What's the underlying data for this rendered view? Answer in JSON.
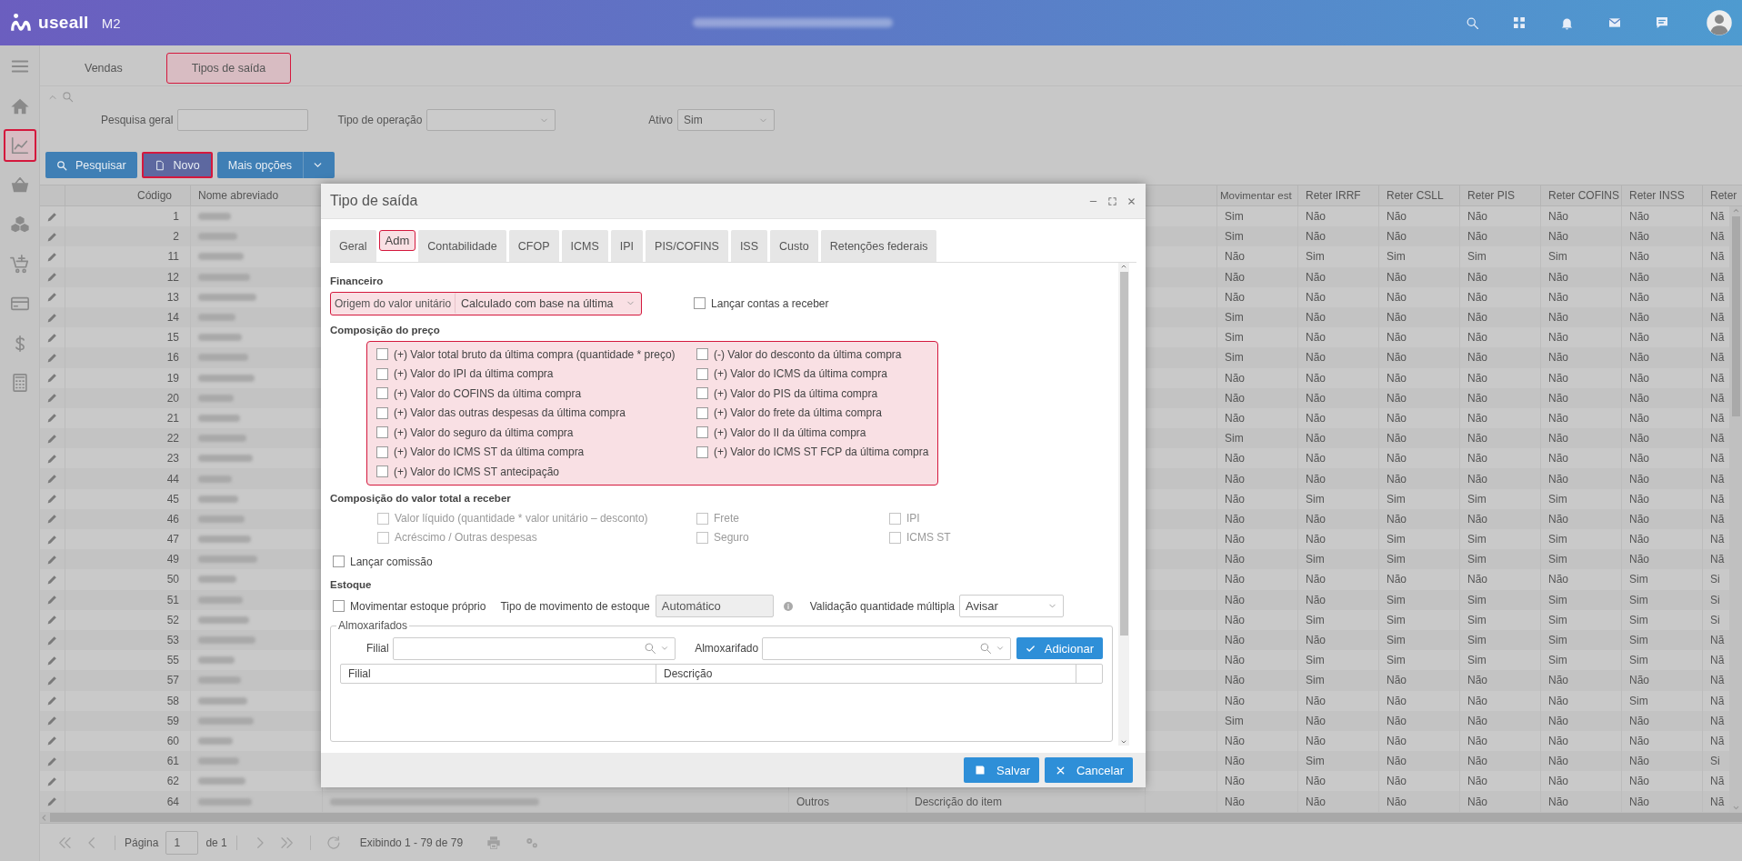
{
  "header": {
    "logo": "useall",
    "product": "M2"
  },
  "sidebar": {
    "items": [
      {
        "kind": "menu",
        "highlighted": false
      },
      {
        "kind": "home",
        "highlighted": false
      },
      {
        "kind": "chart",
        "highlighted": true
      },
      {
        "kind": "basket",
        "highlighted": false
      },
      {
        "kind": "cubes",
        "highlighted": false
      },
      {
        "kind": "cart",
        "highlighted": false
      },
      {
        "kind": "card",
        "highlighted": false
      },
      {
        "kind": "dollar",
        "highlighted": false
      },
      {
        "kind": "calculator",
        "highlighted": false
      }
    ]
  },
  "tabs": [
    {
      "label": "Vendas",
      "selected": false
    },
    {
      "label": "Tipos de saída",
      "selected": true
    }
  ],
  "filters": {
    "search_label": "Pesquisa geral",
    "operation_label": "Tipo de operação",
    "active_label": "Ativo",
    "active_value": "Sim"
  },
  "toolbar": [
    {
      "label": "Pesquisar",
      "kind": "search",
      "highlighted": false
    },
    {
      "label": "Novo",
      "kind": "file",
      "highlighted": true
    },
    {
      "label": "Mais opções",
      "kind": "caret",
      "highlighted": false
    }
  ],
  "table": {
    "columns": [
      "Código",
      "Nome abreviado",
      "",
      "",
      "",
      "",
      "Movimentar est",
      "Reter IRRF",
      "Reter CSLL",
      "Reter PIS",
      "Reter COFINS",
      "Reter INSS",
      "Reter"
    ],
    "rows": [
      {
        "cells": [
          "1",
          "",
          "",
          "",
          "",
          "",
          "Sim",
          "Não",
          "Não",
          "Não",
          "Não",
          "Não",
          "Nã"
        ]
      },
      {
        "cells": [
          "2",
          "",
          "",
          "",
          "",
          "",
          "Sim",
          "Não",
          "Não",
          "Não",
          "Não",
          "Não",
          "Nã"
        ]
      },
      {
        "cells": [
          "11",
          "",
          "",
          "",
          "",
          "",
          "Não",
          "Sim",
          "Sim",
          "Sim",
          "Sim",
          "Não",
          "Nã"
        ]
      },
      {
        "cells": [
          "12",
          "",
          "",
          "",
          "",
          "",
          "Não",
          "Não",
          "Não",
          "Não",
          "Não",
          "Não",
          "Nã"
        ]
      },
      {
        "cells": [
          "13",
          "",
          "",
          "",
          "",
          "",
          "Não",
          "Não",
          "Não",
          "Não",
          "Não",
          "Não",
          "Nã"
        ]
      },
      {
        "cells": [
          "14",
          "",
          "",
          "",
          "",
          "",
          "Sim",
          "Não",
          "Não",
          "Não",
          "Não",
          "Não",
          "Nã"
        ]
      },
      {
        "cells": [
          "15",
          "",
          "",
          "",
          "",
          "",
          "Sim",
          "Não",
          "Não",
          "Não",
          "Não",
          "Não",
          "Nã"
        ]
      },
      {
        "cells": [
          "16",
          "",
          "",
          "",
          "",
          "",
          "Sim",
          "Não",
          "Não",
          "Não",
          "Não",
          "Não",
          "Nã"
        ]
      },
      {
        "cells": [
          "19",
          "",
          "",
          "",
          "",
          "",
          "Não",
          "Não",
          "Não",
          "Não",
          "Não",
          "Não",
          "Nã"
        ]
      },
      {
        "cells": [
          "20",
          "",
          "",
          "",
          "",
          "",
          "Não",
          "Não",
          "Não",
          "Não",
          "Não",
          "Não",
          "Nã"
        ]
      },
      {
        "cells": [
          "21",
          "",
          "",
          "",
          "",
          "",
          "Não",
          "Não",
          "Não",
          "Não",
          "Não",
          "Não",
          "Nã"
        ]
      },
      {
        "cells": [
          "22",
          "",
          "",
          "",
          "",
          "",
          "Sim",
          "Não",
          "Não",
          "Não",
          "Não",
          "Não",
          "Nã"
        ]
      },
      {
        "cells": [
          "23",
          "",
          "",
          "",
          "",
          "",
          "Não",
          "Não",
          "Não",
          "Não",
          "Não",
          "Não",
          "Nã"
        ]
      },
      {
        "cells": [
          "44",
          "",
          "",
          "",
          "",
          "",
          "Não",
          "Não",
          "Não",
          "Não",
          "Não",
          "Não",
          "Nã"
        ]
      },
      {
        "cells": [
          "45",
          "",
          "",
          "",
          "",
          "",
          "Não",
          "Sim",
          "Sim",
          "Sim",
          "Sim",
          "Não",
          "Nã"
        ]
      },
      {
        "cells": [
          "46",
          "",
          "",
          "",
          "",
          "",
          "Não",
          "Não",
          "Não",
          "Não",
          "Não",
          "Não",
          "Nã"
        ]
      },
      {
        "cells": [
          "47",
          "",
          "",
          "",
          "",
          "",
          "Não",
          "Não",
          "Sim",
          "Sim",
          "Sim",
          "Não",
          "Nã"
        ]
      },
      {
        "cells": [
          "49",
          "",
          "",
          "",
          "",
          "",
          "Não",
          "Sim",
          "Sim",
          "Sim",
          "Sim",
          "Não",
          "Nã"
        ]
      },
      {
        "cells": [
          "50",
          "",
          "",
          "",
          "",
          "",
          "Não",
          "Não",
          "Não",
          "Não",
          "Não",
          "Sim",
          "Si"
        ]
      },
      {
        "cells": [
          "51",
          "",
          "",
          "",
          "",
          "",
          "Não",
          "Não",
          "Sim",
          "Sim",
          "Sim",
          "Sim",
          "Si"
        ]
      },
      {
        "cells": [
          "52",
          "",
          "",
          "",
          "",
          "",
          "Não",
          "Sim",
          "Sim",
          "Sim",
          "Sim",
          "Sim",
          "Si"
        ]
      },
      {
        "cells": [
          "53",
          "",
          "",
          "",
          "",
          "",
          "Não",
          "Não",
          "Sim",
          "Sim",
          "Sim",
          "Sim",
          "Nã"
        ]
      },
      {
        "cells": [
          "55",
          "",
          "",
          "",
          "",
          "",
          "Não",
          "Sim",
          "Sim",
          "Sim",
          "Sim",
          "Sim",
          "Nã"
        ]
      },
      {
        "cells": [
          "57",
          "",
          "",
          "",
          "",
          "",
          "Não",
          "Sim",
          "Não",
          "Não",
          "Não",
          "Não",
          "Nã"
        ]
      },
      {
        "cells": [
          "58",
          "",
          "",
          "",
          "",
          "",
          "Não",
          "Não",
          "Não",
          "Não",
          "Não",
          "Sim",
          "Nã"
        ]
      },
      {
        "cells": [
          "59",
          "",
          "",
          "",
          "",
          "",
          "Sim",
          "Não",
          "Não",
          "Não",
          "Não",
          "Não",
          "Nã"
        ]
      },
      {
        "cells": [
          "60",
          "",
          "",
          "",
          "",
          "",
          "Não",
          "Não",
          "Não",
          "Não",
          "Não",
          "Não",
          "Nã"
        ]
      },
      {
        "cells": [
          "61",
          "",
          "",
          "",
          "",
          "",
          "Não",
          "Sim",
          "Não",
          "Não",
          "Não",
          "Não",
          "Si"
        ]
      },
      {
        "cells": [
          "62",
          "",
          "",
          "",
          "",
          "",
          "Não",
          "Não",
          "Não",
          "Não",
          "Não",
          "Não",
          "Nã"
        ]
      },
      {
        "cells": [
          "64",
          "",
          "",
          "Outros",
          "Descrição do item",
          "",
          "Não",
          "Não",
          "Não",
          "Não",
          "Não",
          "Não",
          "Nã"
        ]
      }
    ]
  },
  "pager": {
    "page_label": "Página",
    "page": "1",
    "page_total": "de 1",
    "summary": "Exibindo 1 - 79 de 79"
  },
  "modal": {
    "title": "Tipo de saída",
    "tabs": [
      {
        "label": "Geral",
        "selected": false
      },
      {
        "label": "Adm",
        "selected": true
      },
      {
        "label": "Contabilidade",
        "selected": false
      },
      {
        "label": "CFOP",
        "selected": false
      },
      {
        "label": "ICMS",
        "selected": false
      },
      {
        "label": "IPI",
        "selected": false
      },
      {
        "label": "PIS/COFINS",
        "selected": false
      },
      {
        "label": "ISS",
        "selected": false
      },
      {
        "label": "Custo",
        "selected": false
      },
      {
        "label": "Retenções federais",
        "selected": false
      }
    ],
    "financeiro": {
      "heading": "Financeiro",
      "origin_label": "Origem do valor unitário",
      "origin_value": "Calculado com base na última",
      "highlighted": true,
      "receivable": {
        "label": "Lançar contas a receber",
        "checked": false
      }
    },
    "price": {
      "heading": "Composição do preço",
      "highlighted": true,
      "columns": [
        [
          {
            "label": "(+) Valor total bruto da última compra (quantidade * preço)",
            "checked": false
          },
          {
            "label": "(+) Valor do IPI da última compra",
            "checked": false
          },
          {
            "label": "(+) Valor do COFINS da última compra",
            "checked": false
          },
          {
            "label": "(+) Valor das outras despesas da última compra",
            "checked": false
          },
          {
            "label": "(+) Valor do seguro da última compra",
            "checked": false
          },
          {
            "label": "(+) Valor do ICMS ST da última compra",
            "checked": false
          },
          {
            "label": "(+) Valor do ICMS ST antecipação",
            "checked": false
          }
        ],
        [
          {
            "label": "(-) Valor do desconto da última compra",
            "checked": false
          },
          {
            "label": "(+) Valor do ICMS da última compra",
            "checked": false
          },
          {
            "label": "(+) Valor do PIS da última compra",
            "checked": false
          },
          {
            "label": "(+) Valor do frete da última compra",
            "checked": false
          },
          {
            "label": "(+) Valor do II da última compra",
            "checked": false
          },
          {
            "label": "(+) Valor do ICMS ST FCP da última compra",
            "checked": false
          }
        ]
      ]
    },
    "total": {
      "heading": "Composição do valor total a receber",
      "columns": [
        [
          {
            "label": "Valor líquido (quantidade * valor unitário – desconto)",
            "checked": false,
            "disabled": true
          },
          {
            "label": "Acréscimo / Outras despesas",
            "checked": false,
            "disabled": true
          }
        ],
        [
          {
            "label": "Frete",
            "checked": false,
            "disabled": true
          },
          {
            "label": "Seguro",
            "checked": false,
            "disabled": true
          }
        ],
        [
          {
            "label": "IPI",
            "checked": false,
            "disabled": true
          },
          {
            "label": "ICMS ST",
            "checked": false,
            "disabled": true
          }
        ]
      ]
    },
    "commission": {
      "label": "Lançar comissão",
      "checked": false
    },
    "stock": {
      "heading": "Estoque",
      "own": {
        "label": "Movimentar estoque próprio",
        "checked": false
      },
      "movement_label": "Tipo de movimento de estoque",
      "movement_value": "Automático",
      "validation_label": "Validação quantidade múltipla",
      "validation_value": "Avisar"
    },
    "warehouses": {
      "legend": "Almoxarifados",
      "branch_label": "Filial",
      "warehouse_label": "Almoxarifado",
      "add": "Adicionar",
      "columns": [
        "Filial",
        "Descrição"
      ]
    },
    "buttons": [
      {
        "label": "Salvar",
        "kind": "save"
      },
      {
        "label": "Cancelar",
        "kind": "cancel"
      }
    ]
  }
}
